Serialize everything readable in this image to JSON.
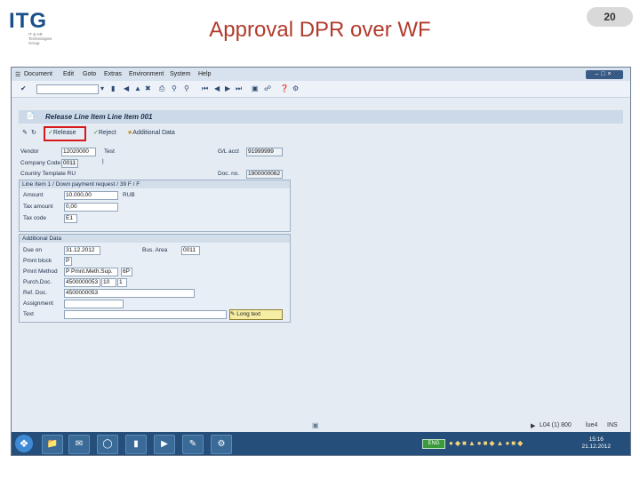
{
  "slide": {
    "logo_text": "ITG",
    "logo_subtitle": "IT & HR Technologies Group",
    "title": "Approval DPR over WF",
    "page_number": "20"
  },
  "menubar": {
    "items": [
      "Document",
      "Edit",
      "Goto",
      "Extras",
      "Environment",
      "System",
      "Help"
    ]
  },
  "transaction": {
    "title": "Release Line Item Line Item 001",
    "app_toolbar": {
      "release_label": "Release",
      "reject_label": "Reject",
      "additional_data_label": "Additional Data"
    }
  },
  "header_fields": {
    "vendor_label": "Vendor",
    "vendor_value": "12020000",
    "vendor_text": "Test",
    "gl_acct_label": "G/L acct",
    "gl_acct_value": "91999999",
    "company_code_label": "Company Code",
    "company_code_value": "0011",
    "doc_no_label": "Doc. no.",
    "doc_no_value": "1900000062",
    "country_template_label": "Country Template RU"
  },
  "line_item_group": {
    "title": "Line Item 1 / Down payment request / 39 F / F",
    "amount_label": "Amount",
    "amount_value": "10.000,00",
    "currency": "RUB",
    "tax_amount_label": "Tax amount",
    "tax_amount_value": "0,00",
    "tax_code_label": "Tax code",
    "tax_code_value": "E1"
  },
  "additional_group": {
    "title": "Additional Data",
    "due_on_label": "Due on",
    "due_on_value": "31.12.2012",
    "bus_area_label": "Bus. Area",
    "bus_area_value": "0011",
    "pmnt_block_label": "Pmnt block",
    "pmnt_block_value": "P",
    "pmnt_method_label": "Pmnt Method",
    "pmnt_method_value": "P Pmnt.Meth.Sup.",
    "pmnt_method_code": "6P",
    "purch_doc_label": "Purch.Doc.",
    "purch_doc_value": "4500000053",
    "purch_doc_item": "10",
    "purch_doc_extra": "1",
    "ref_doc_label": "Ref. Doc.",
    "ref_doc_value": "4500000053",
    "assignment_label": "Assignment",
    "assignment_value": "",
    "text_label": "Text",
    "text_value": "",
    "long_text_label": "Long text"
  },
  "status": {
    "server_info": "L04 (1) 800",
    "host": "lue4",
    "mode": "INS"
  },
  "taskbar": {
    "tray_badge": "ENG",
    "clock_time": "15:16",
    "clock_date": "21.12.2012"
  },
  "colors": {
    "title_red": "#b23a2c",
    "sap_bg": "#e4ebf3",
    "taskbar_blue": "#254f7a",
    "highlight_red": "#d61a1a"
  }
}
